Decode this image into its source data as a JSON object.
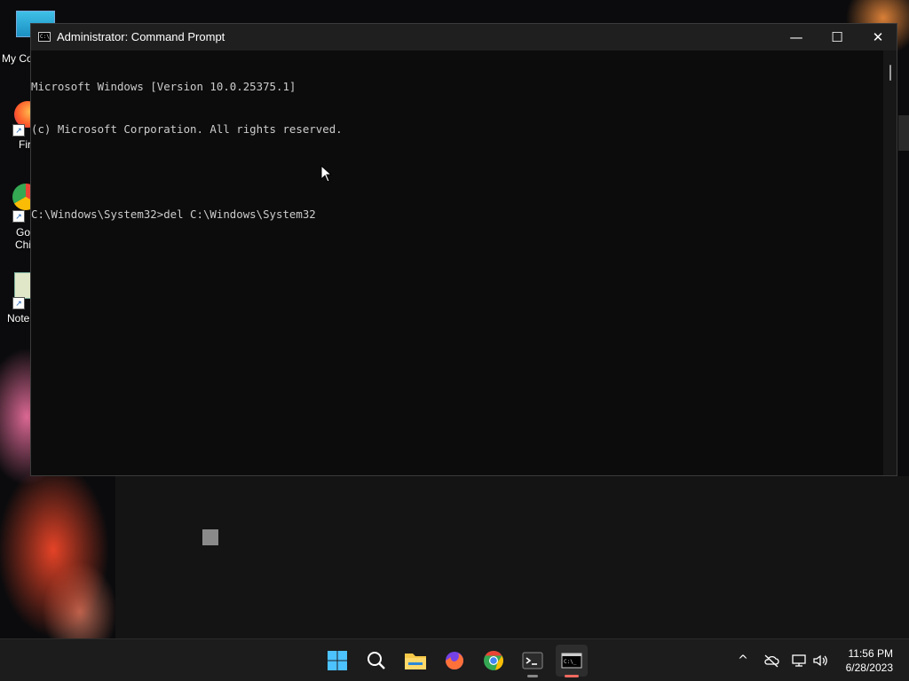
{
  "desktop": {
    "icons": [
      {
        "label": "My Co"
      },
      {
        "label": "Fir"
      },
      {
        "label": "Go"
      },
      {
        "label": "Chi"
      },
      {
        "label": "Note"
      }
    ]
  },
  "window": {
    "title": "Administrator: Command Prompt",
    "icon_text": "C:\\",
    "minimize_glyph": "—",
    "maximize_glyph": "☐",
    "close_glyph": "✕",
    "console_lines": [
      "Microsoft Windows [Version 10.0.25375.1]",
      "(c) Microsoft Corporation. All rights reserved.",
      "",
      "C:\\Windows\\System32>del C:\\Windows\\System32"
    ]
  },
  "taskbar": {
    "apps": [
      {
        "name": "start-button"
      },
      {
        "name": "search-button"
      },
      {
        "name": "file-explorer"
      },
      {
        "name": "firefox"
      },
      {
        "name": "chrome"
      },
      {
        "name": "terminal"
      },
      {
        "name": "command-prompt"
      }
    ],
    "tray": {
      "chevron": "^",
      "time": "11:56 PM",
      "date": "6/28/2023"
    }
  },
  "colors": {
    "console_bg": "#0c0c0c",
    "console_text": "#cccccc",
    "titlebar": "#1f1f1f",
    "taskbar": "#1c1c1c",
    "active_indicator": "#f0695f"
  }
}
